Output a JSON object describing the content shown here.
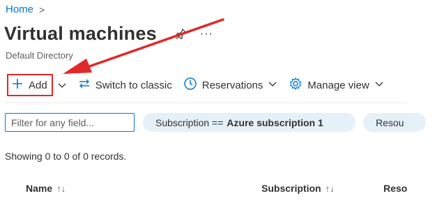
{
  "breadcrumb": {
    "home": "Home",
    "separator": ">"
  },
  "header": {
    "title": "Virtual machines",
    "subtitle": "Default Directory",
    "more": "···"
  },
  "toolbar": {
    "add_label": "Add",
    "switch_label": "Switch to classic",
    "reservations_label": "Reservations",
    "manage_view_label": "Manage view"
  },
  "filter": {
    "placeholder": "Filter for any field...",
    "subscription_prefix": "Subscription ==",
    "subscription_value": "Azure subscription 1",
    "resource_pill": "Resou"
  },
  "records_text": "Showing 0 to 0 of 0 records.",
  "table": {
    "columns": [
      {
        "label": "Name",
        "sort": "↑↓"
      },
      {
        "label": "Subscription",
        "sort": "↑↓"
      },
      {
        "label": "Reso",
        "sort": ""
      }
    ]
  },
  "colors": {
    "accent": "#0078d4",
    "annotation": "#e0282a",
    "pill_bg": "#e6f0f9"
  },
  "icons": [
    "plus-icon",
    "chevron-down-icon",
    "swap-arrows-icon",
    "clock-icon",
    "gear-icon",
    "pin-icon"
  ]
}
